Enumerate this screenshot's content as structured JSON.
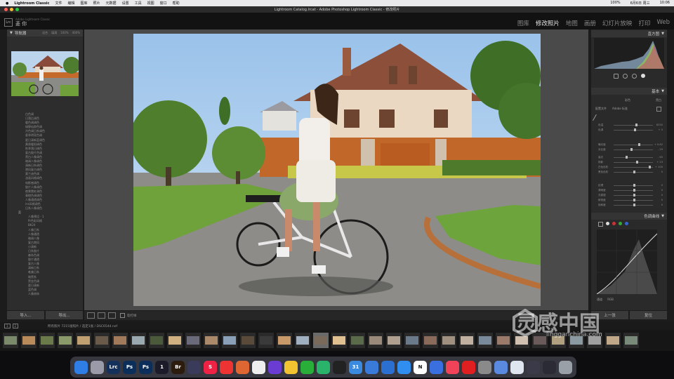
{
  "menubar": {
    "app": "Lightroom Classic",
    "items": [
      "文件",
      "编辑",
      "图库",
      "照片",
      "元数据",
      "设置",
      "工具",
      "视图",
      "窗口",
      "帮助"
    ],
    "right": [
      "100%",
      "6月6日 周三",
      "10:06"
    ]
  },
  "window": {
    "title": "Lightroom Catalog.lrcat - Adobe Photoshop Lightroom Classic - 修改照片"
  },
  "identity": {
    "logo": "Lrc",
    "small": "Adobe Lightroom Classic",
    "name": "菱 你"
  },
  "modules": [
    {
      "label": "图库",
      "active": false
    },
    {
      "label": "修改照片",
      "active": true
    },
    {
      "label": "地图",
      "active": false
    },
    {
      "label": "画册",
      "active": false
    },
    {
      "label": "幻灯片放映",
      "active": false
    },
    {
      "label": "打印",
      "active": false
    },
    {
      "label": "Web",
      "active": false
    }
  ],
  "navigator": {
    "title": "导航器",
    "options": [
      "适合",
      "填满",
      "100%",
      "400%"
    ]
  },
  "presets": [
    "白色调",
    "日落后调色",
    "暖色调调色",
    "绿野仙踪色调",
    "冷色调日系调色",
    "夏季明亮色调",
    "夏日清新蓝调色",
    "黄昏暖阳调色",
    "秋季落日调色",
    "复古胶片色调",
    "黑白人像调色",
    "暗调人像调色",
    "清新日系调色",
    "港风复古调色",
    "莫兰迪色调",
    "油画风格调色",
    "电影感调色",
    "胶片人像调色",
    "夜景霓虹调色",
    "青橙色调调色",
    "人像通透调色",
    "ins风格调色",
    "日系人像调色"
  ],
  "presets_folder": "菜",
  "presets_sub": [
    "人像预设 - 1",
    "Pr色彩风格",
    "BK24",
    "人像日系",
    "人像通透",
    "暗调人像",
    "复古港风",
    "小清新",
    "日系胶片",
    "森系色调",
    "胶片通透",
    "复古人像",
    "清新日系",
    "唯美日系",
    "暗黑系",
    "黑金色调",
    "夏日清新",
    "蓝色调",
    "人像修饰"
  ],
  "left_buttons": [
    "导入...",
    "导出..."
  ],
  "right_panel": {
    "histogram_title": "直方图",
    "basic_title": "基本",
    "treatment": [
      "彩色",
      "黑白"
    ],
    "profile_label": "配置文件",
    "profile_value": "Adobe 标准",
    "sliders": [
      {
        "label": "色温",
        "value": "6250"
      },
      {
        "label": "色调",
        "value": "+ 5"
      },
      {
        "label": "曝光度",
        "value": "+ 0.82"
      },
      {
        "label": "对比度",
        "value": "- 29"
      },
      {
        "label": "高光",
        "value": "- 65"
      },
      {
        "label": "阴影",
        "value": "+ 23"
      },
      {
        "label": "白色色阶",
        "value": "+ 100"
      },
      {
        "label": "黑色色阶",
        "value": "0"
      },
      {
        "label": "纹理",
        "value": "0"
      },
      {
        "label": "清晰度",
        "value": "0"
      },
      {
        "label": "去朦胧",
        "value": "0"
      },
      {
        "label": "鲜艳度",
        "value": "0"
      },
      {
        "label": "饱和度",
        "value": "0"
      }
    ],
    "tone_curve_title": "色调曲线",
    "curve_channel": "通道",
    "curve_value": "RGB",
    "buttons": [
      "上一张",
      "复位"
    ]
  },
  "toolbar": {
    "label": "软打样"
  },
  "filmstrip": {
    "pages": [
      "1",
      "2"
    ],
    "path": "所有照片  7215张照片 / 选定1张 / DSC6544.nef"
  },
  "watermark": {
    "text": "灵感中国",
    "sub": "lingganchina.com"
  },
  "dock": {
    "apps": [
      {
        "name": "finder",
        "label": "",
        "color": "#2f7ee6"
      },
      {
        "name": "launchpad",
        "label": "",
        "color": "#9a9aa8"
      },
      {
        "name": "lightroom",
        "label": "Lrc",
        "color": "#14315c"
      },
      {
        "name": "photoshop",
        "label": "Ps",
        "color": "#0b2f5a"
      },
      {
        "name": "photoshop-2",
        "label": "Ps",
        "color": "#0b2f5a"
      },
      {
        "name": "onepassword",
        "label": "1",
        "color": "#1b1b2a"
      },
      {
        "name": "bridge",
        "label": "Br",
        "color": "#2b1c0e"
      },
      {
        "name": "app-grid",
        "label": "",
        "color": "#3a3a5a"
      },
      {
        "name": "app-s",
        "label": "S",
        "color": "#e24"
      },
      {
        "name": "app-q",
        "label": "",
        "color": "#e33"
      },
      {
        "name": "app-red",
        "label": "",
        "color": "#d63"
      },
      {
        "name": "app-v",
        "label": "",
        "color": "#eee"
      },
      {
        "name": "app-gem",
        "label": "",
        "color": "#6a3cd4"
      },
      {
        "name": "chrome",
        "label": "",
        "color": "#f2c230"
      },
      {
        "name": "wechat",
        "label": "",
        "color": "#2aae3a"
      },
      {
        "name": "app-send",
        "label": "",
        "color": "#29b36b"
      },
      {
        "name": "qq",
        "label": "",
        "color": "#222"
      },
      {
        "name": "app-31",
        "label": "31",
        "color": "#3a8be0"
      },
      {
        "name": "app-link",
        "label": "",
        "color": "#3a7ad8"
      },
      {
        "name": "app-play",
        "label": "",
        "color": "#2b6fd0"
      },
      {
        "name": "appstore",
        "label": "",
        "color": "#2f8ef0"
      },
      {
        "name": "notion",
        "label": "N",
        "color": "#fff"
      },
      {
        "name": "app-list",
        "label": "",
        "color": "#3a6fe0"
      },
      {
        "name": "music",
        "label": "",
        "color": "#f0435a"
      },
      {
        "name": "netease",
        "label": "",
        "color": "#e02020"
      },
      {
        "name": "settings",
        "label": "",
        "color": "#8a8a8a"
      },
      {
        "name": "app-bird",
        "label": "",
        "color": "#5a8ae0"
      },
      {
        "name": "app-search",
        "label": "",
        "color": "#dfe6ef"
      },
      {
        "name": "app-screen",
        "label": "",
        "color": "#3a3a48"
      },
      {
        "name": "app-screen-2",
        "label": "",
        "color": "#2b2b35"
      },
      {
        "name": "trash",
        "label": "",
        "color": "#9aa0a8"
      }
    ]
  }
}
